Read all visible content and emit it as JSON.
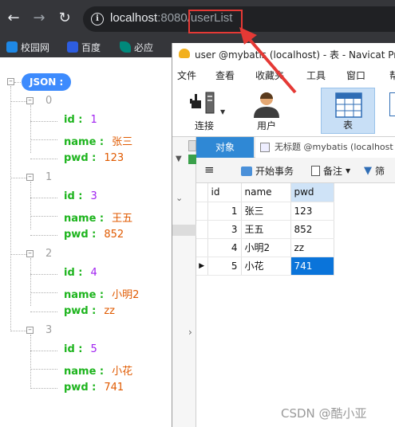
{
  "browser": {
    "url_host": "localhost",
    "url_port": ":8080",
    "url_path": "/userList",
    "bookmarks": [
      "校园网",
      "百度",
      "必应"
    ]
  },
  "json_viewer": {
    "root_label": "JSON :",
    "items": [
      {
        "index": "0",
        "id_key": "id :",
        "id": "1",
        "name_key": "name :",
        "name": "张三",
        "pwd_key": "pwd :",
        "pwd": "123"
      },
      {
        "index": "1",
        "id_key": "id :",
        "id": "3",
        "name_key": "name :",
        "name": "王五",
        "pwd_key": "pwd :",
        "pwd": "852"
      },
      {
        "index": "2",
        "id_key": "id :",
        "id": "4",
        "name_key": "name :",
        "name": "小明2",
        "pwd_key": "pwd :",
        "pwd": "zz"
      },
      {
        "index": "3",
        "id_key": "id :",
        "id": "5",
        "name_key": "name :",
        "name": "小花",
        "pwd_key": "pwd :",
        "pwd": "741"
      }
    ]
  },
  "navicat": {
    "title": "user @mybatis (localhost) - 表 - Navicat Pre",
    "menu": [
      "文件",
      "查看",
      "收藏夹",
      "工具",
      "窗口",
      "帮"
    ],
    "toolbar": {
      "connect": "连接",
      "user": "用户",
      "table": "表"
    },
    "tabs": {
      "objects": "对象",
      "query": "无标题 @mybatis (localhost"
    },
    "subbar": {
      "begin_transaction": "开始事务",
      "notes": "备注",
      "filter": "筛"
    },
    "grid": {
      "columns": [
        "id",
        "name",
        "pwd"
      ],
      "rows": [
        {
          "id": "1",
          "name": "张三",
          "pwd": "123"
        },
        {
          "id": "3",
          "name": "王五",
          "pwd": "852"
        },
        {
          "id": "4",
          "name": "小明2",
          "pwd": "zz"
        },
        {
          "id": "5",
          "name": "小花",
          "pwd": "741"
        }
      ]
    }
  },
  "watermark": "CSDN @酷小亚",
  "colors": {
    "json_key": "#1db41d",
    "json_num": "#a020f0",
    "json_str": "#e05a00",
    "selection": "#0a74da",
    "annotation": "#e53935"
  }
}
